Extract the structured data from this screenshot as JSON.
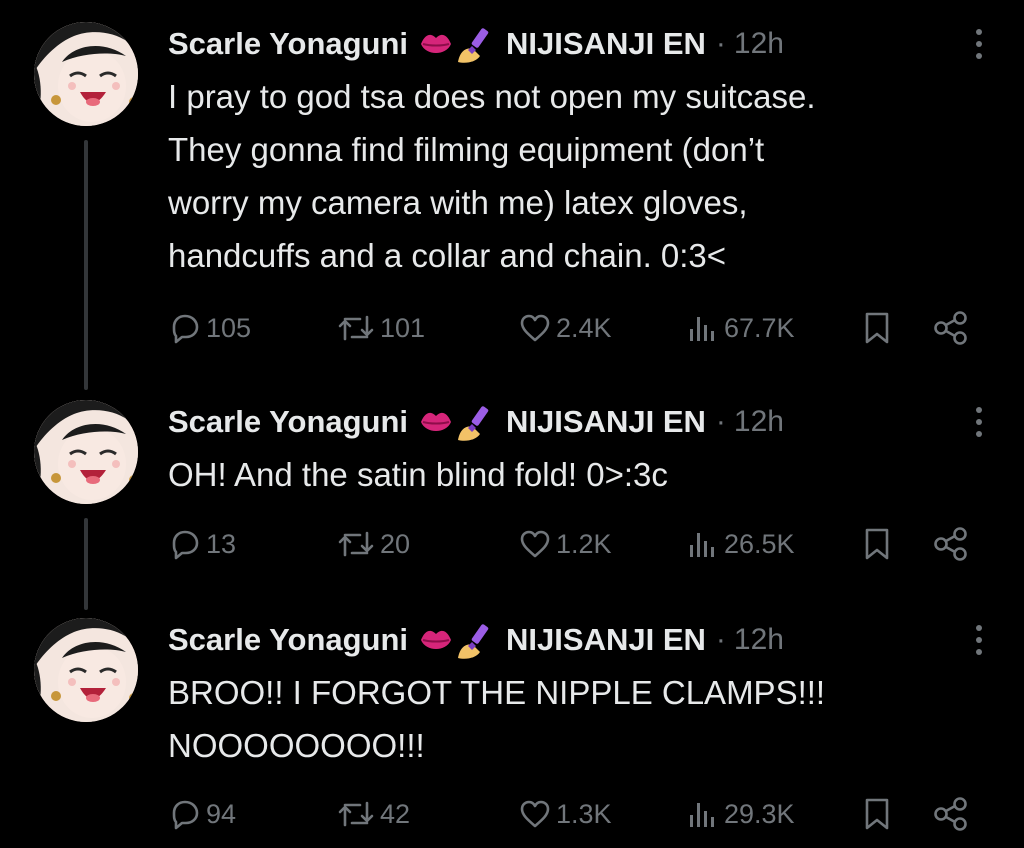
{
  "colors": {
    "background": "#000000",
    "text_primary": "#e7e9ea",
    "text_secondary": "#71767b",
    "thread_line": "#333639",
    "lips_emoji": "#d6257a",
    "nail_polish_emoji": "#9b5de5"
  },
  "tweets": [
    {
      "author_name": "Scarle Yonaguni",
      "emojis": [
        "lips-emoji",
        "nail-polish-emoji"
      ],
      "affiliation": "NIJISANJI EN",
      "separator": "·",
      "time": "12h",
      "text": "I pray to god tsa does not open my suitcase.\nThey gonna find filming equipment (don’t\nworry my camera with me) latex gloves,\nhandcuffs and a collar and chain. 0:3<",
      "replies": "105",
      "reposts": "101",
      "likes": "2.4K",
      "views": "67.7K"
    },
    {
      "author_name": "Scarle Yonaguni",
      "emojis": [
        "lips-emoji",
        "nail-polish-emoji"
      ],
      "affiliation": "NIJISANJI EN",
      "separator": "·",
      "time": "12h",
      "text": "OH! And the satin blind fold! 0>:3c",
      "replies": "13",
      "reposts": "20",
      "likes": "1.2K",
      "views": "26.5K"
    },
    {
      "author_name": "Scarle Yonaguni",
      "emojis": [
        "lips-emoji",
        "nail-polish-emoji"
      ],
      "affiliation": "NIJISANJI EN",
      "separator": "·",
      "time": "12h",
      "text": "BROO!! I FORGOT THE NIPPLE CLAMPS!!!\nNOOOOOOOO!!!",
      "replies": "94",
      "reposts": "42",
      "likes": "1.3K",
      "views": "29.3K"
    }
  ],
  "icons": {
    "reply": "reply-icon",
    "repost": "repost-icon",
    "like": "heart-icon",
    "views": "views-icon",
    "bookmark": "bookmark-icon",
    "share": "share-icon",
    "more": "more-icon"
  }
}
